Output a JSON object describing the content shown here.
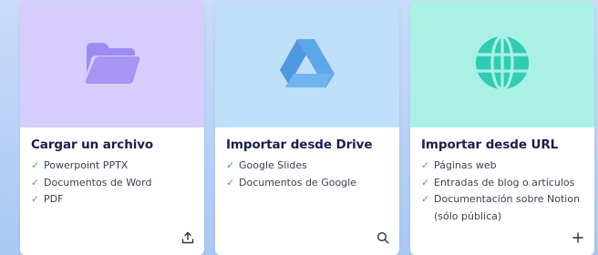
{
  "cards": [
    {
      "title": "Cargar un archivo",
      "icon": "folder-icon",
      "banner_color": "#d6cdfc",
      "icon_color": "#a391f4",
      "features": [
        "Powerpoint PPTX",
        "Documentos de Word",
        "PDF"
      ],
      "action_icon": "upload-icon"
    },
    {
      "title": "Importar desde Drive",
      "icon": "google-drive-icon",
      "banner_color": "#bfdff8",
      "icon_color": "#5ca6ea",
      "features": [
        "Google Slides",
        "Documentos de Google"
      ],
      "action_icon": "search-icon"
    },
    {
      "title": "Importar desde URL",
      "icon": "globe-icon",
      "banner_color": "#abf0e4",
      "icon_color": "#2fcdb3",
      "features": [
        "Páginas web",
        "Entradas de blog o artículos",
        "Documentación sobre Notion",
        "(sólo pública)"
      ],
      "action_icon": "plus-icon"
    }
  ],
  "check_glyph": "✓",
  "accent_check_color": "#3fae59"
}
